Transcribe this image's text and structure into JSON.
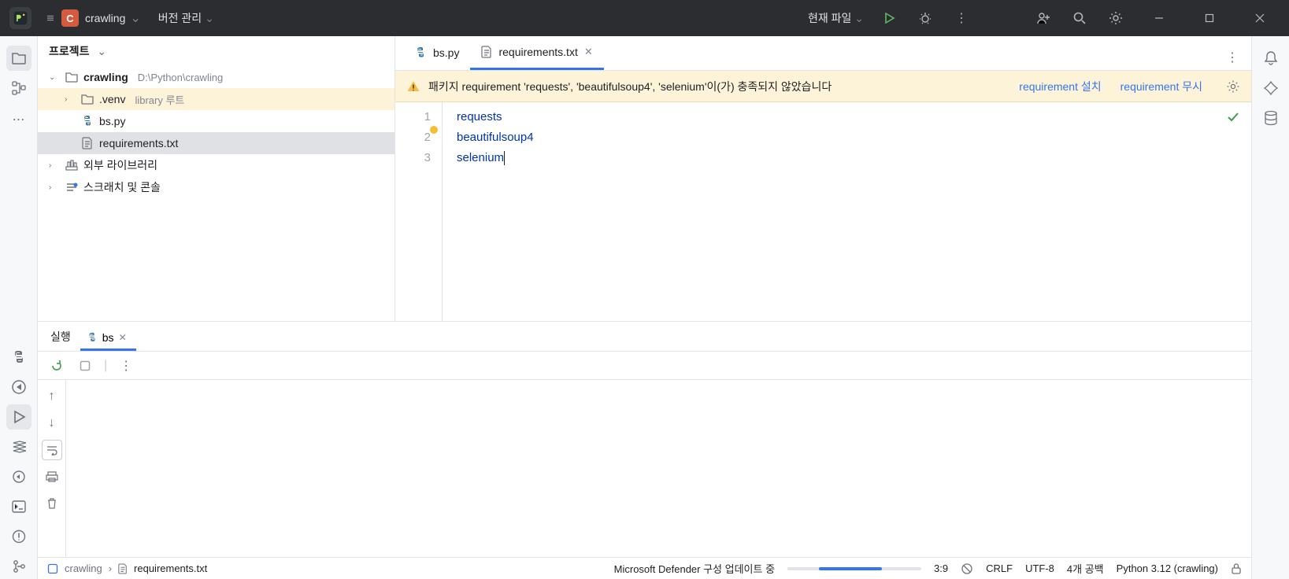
{
  "titlebar": {
    "project_initial": "C",
    "project_name": "crawling",
    "vcs_label": "버전 관리",
    "run_config": "현재 파일"
  },
  "project_panel": {
    "title": "프로젝트",
    "root_name": "crawling",
    "root_path": "D:\\Python\\crawling",
    "items": [
      {
        "name": ".venv",
        "hint": "library 루트"
      },
      {
        "name": "bs.py"
      },
      {
        "name": "requirements.txt"
      }
    ],
    "external_libs": "외부 라이브러리",
    "scratches": "스크래치 및 콘솔"
  },
  "editor": {
    "tabs": [
      {
        "label": "bs.py"
      },
      {
        "label": "requirements.txt"
      }
    ],
    "banner_text": "패키지 requirement 'requests', 'beautifulsoup4', 'selenium'이(가) 충족되지 않았습니다",
    "banner_link_install": "requirement 설치",
    "banner_link_ignore": "requirement 무시",
    "lines": [
      "requests",
      "beautifulsoup4",
      "selenium"
    ]
  },
  "run": {
    "title": "실행",
    "tab_label": "bs"
  },
  "status": {
    "breadcrumb_root": "crawling",
    "breadcrumb_file": "requirements.txt",
    "progress_label": "Microsoft Defender 구성 업데이트 중",
    "cursor_pos": "3:9",
    "line_sep": "CRLF",
    "encoding": "UTF-8",
    "indent": "4개 공백",
    "interpreter": "Python 3.12 (crawling)"
  }
}
